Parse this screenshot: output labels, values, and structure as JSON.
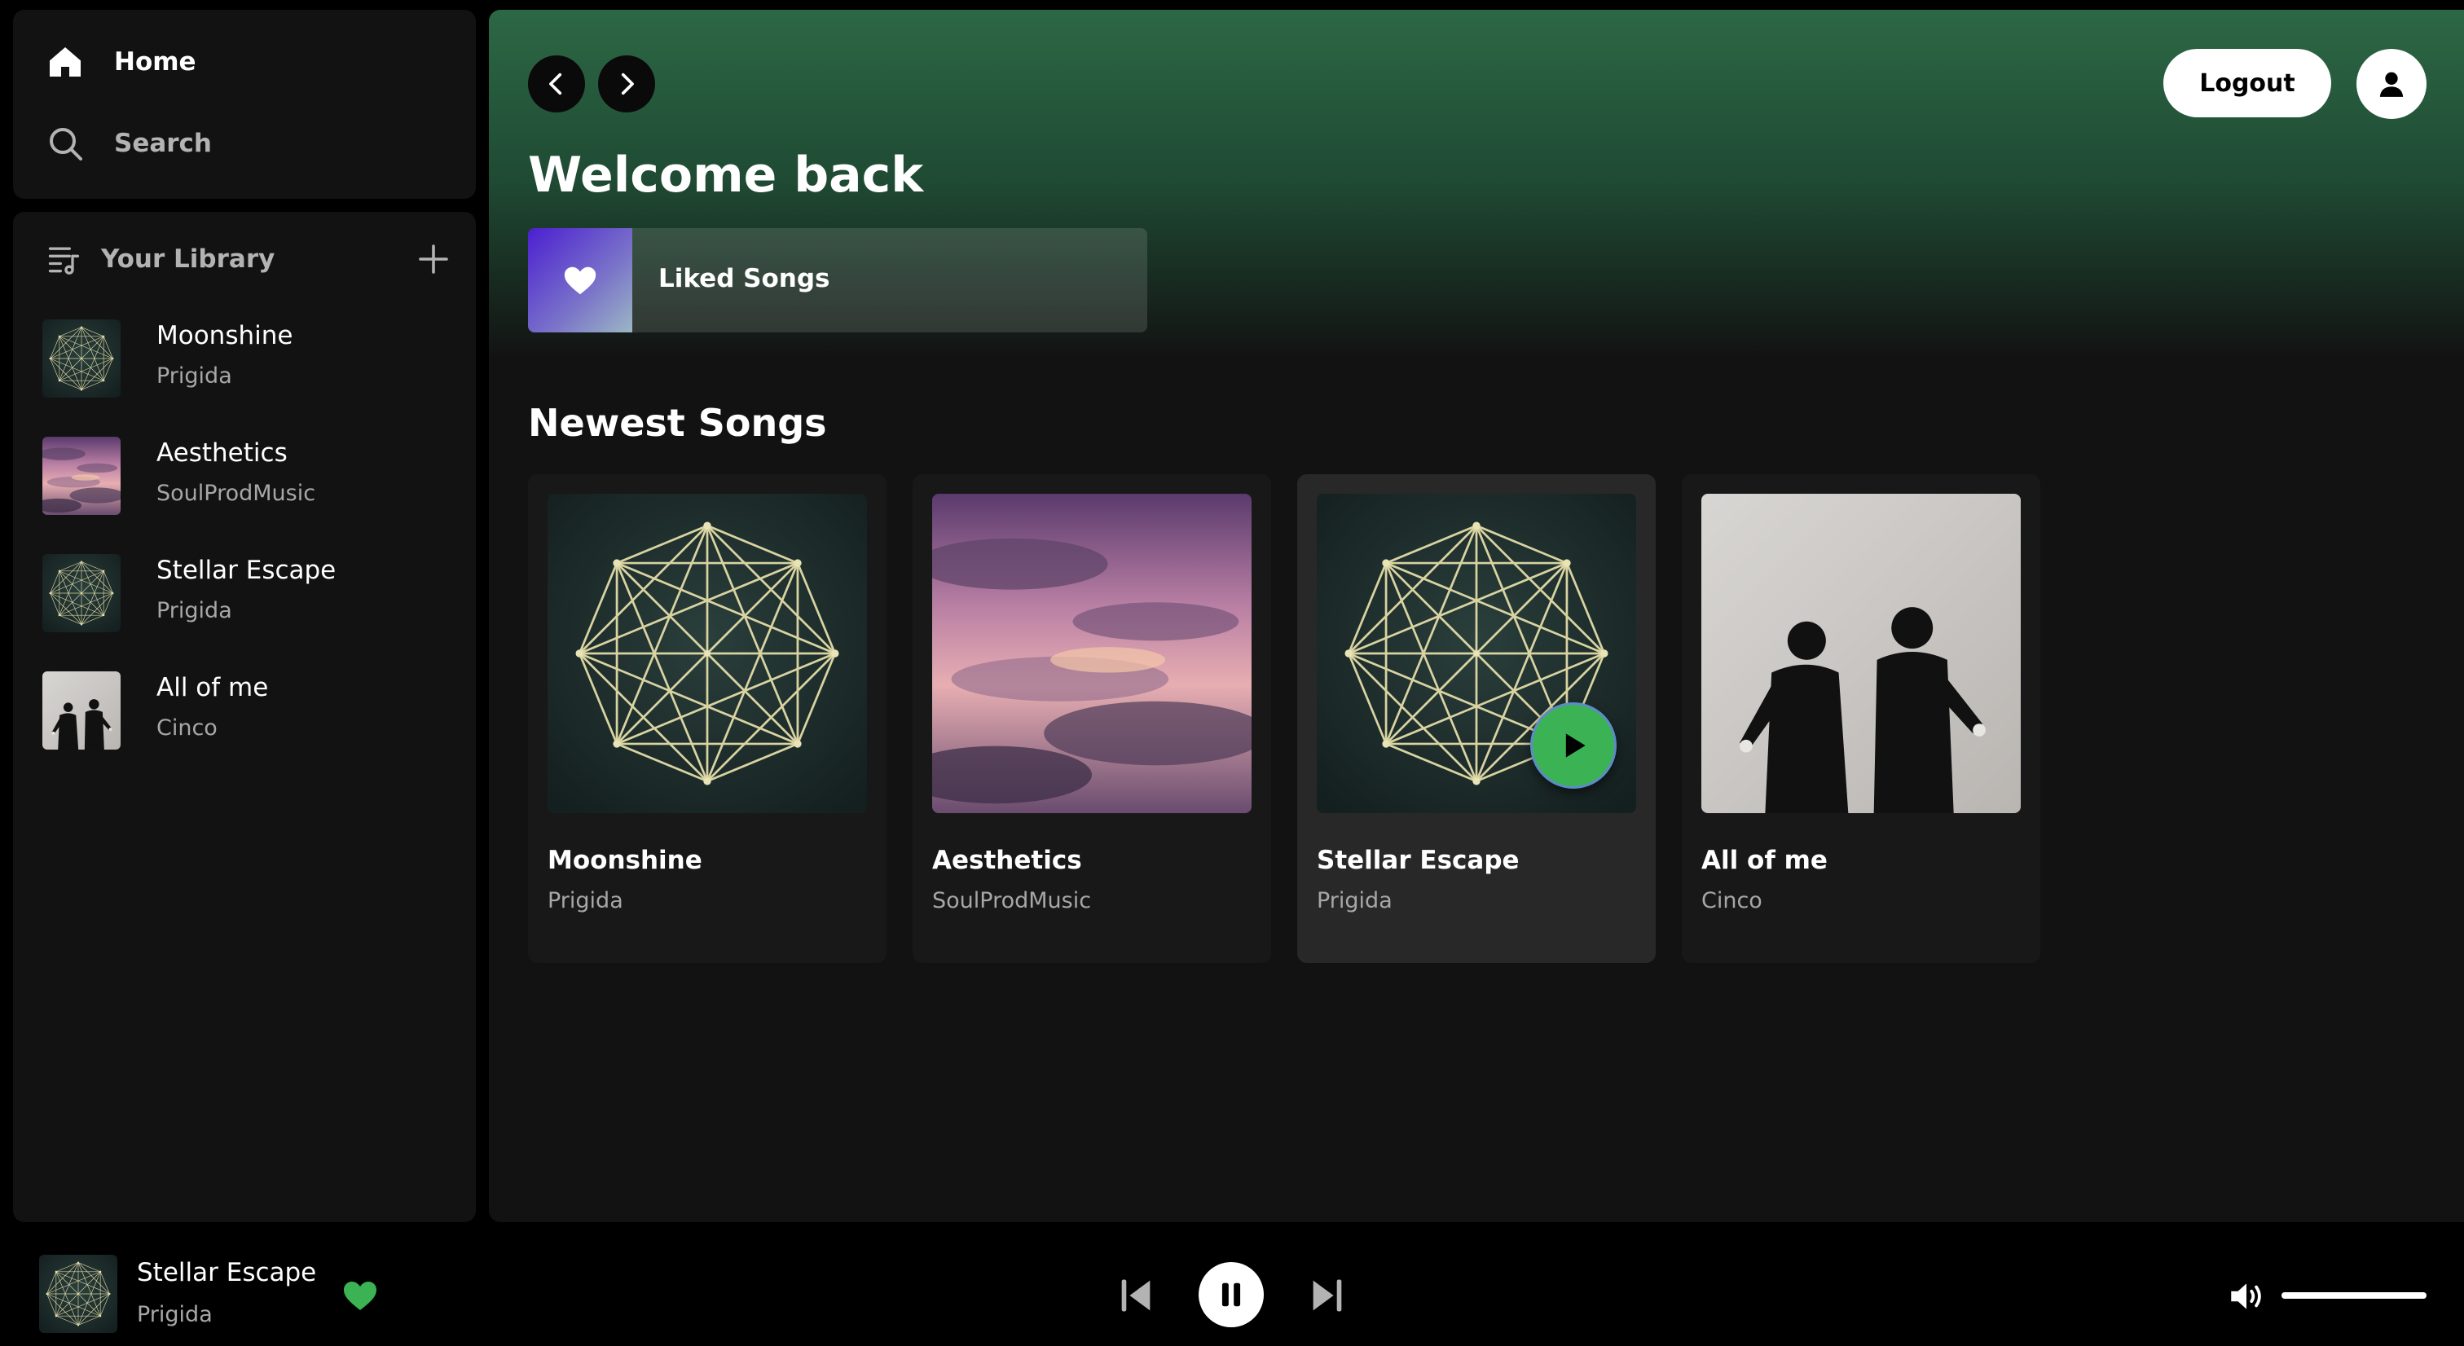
{
  "nav": {
    "home_label": "Home",
    "search_label": "Search"
  },
  "library": {
    "title": "Your Library",
    "items": [
      {
        "title": "Moonshine",
        "artist": "Prigida",
        "art": "geometric-octagon"
      },
      {
        "title": "Aesthetics",
        "artist": "SoulProdMusic",
        "art": "pink-sky-clouds"
      },
      {
        "title": "Stellar Escape",
        "artist": "Prigida",
        "art": "geometric-octagon"
      },
      {
        "title": "All of me",
        "artist": "Cinco",
        "art": "two-men-sketch"
      }
    ]
  },
  "header": {
    "logout_label": "Logout"
  },
  "main": {
    "welcome": "Welcome back",
    "liked_songs_label": "Liked Songs",
    "newest_title": "Newest Songs",
    "songs": [
      {
        "title": "Moonshine",
        "artist": "Prigida",
        "art": "geometric-octagon"
      },
      {
        "title": "Aesthetics",
        "artist": "SoulProdMusic",
        "art": "pink-sky-clouds"
      },
      {
        "title": "Stellar Escape",
        "artist": "Prigida",
        "art": "geometric-octagon",
        "hovered": true
      },
      {
        "title": "All of me",
        "artist": "Cinco",
        "art": "two-men-sketch"
      }
    ]
  },
  "player": {
    "title": "Stellar Escape",
    "artist": "Prigida",
    "liked": true,
    "state": "playing",
    "volume": 1.0
  },
  "colors": {
    "accent_green": "#1ed760",
    "main_gradient_top": "#2c6845",
    "panel_bg": "#121212"
  }
}
